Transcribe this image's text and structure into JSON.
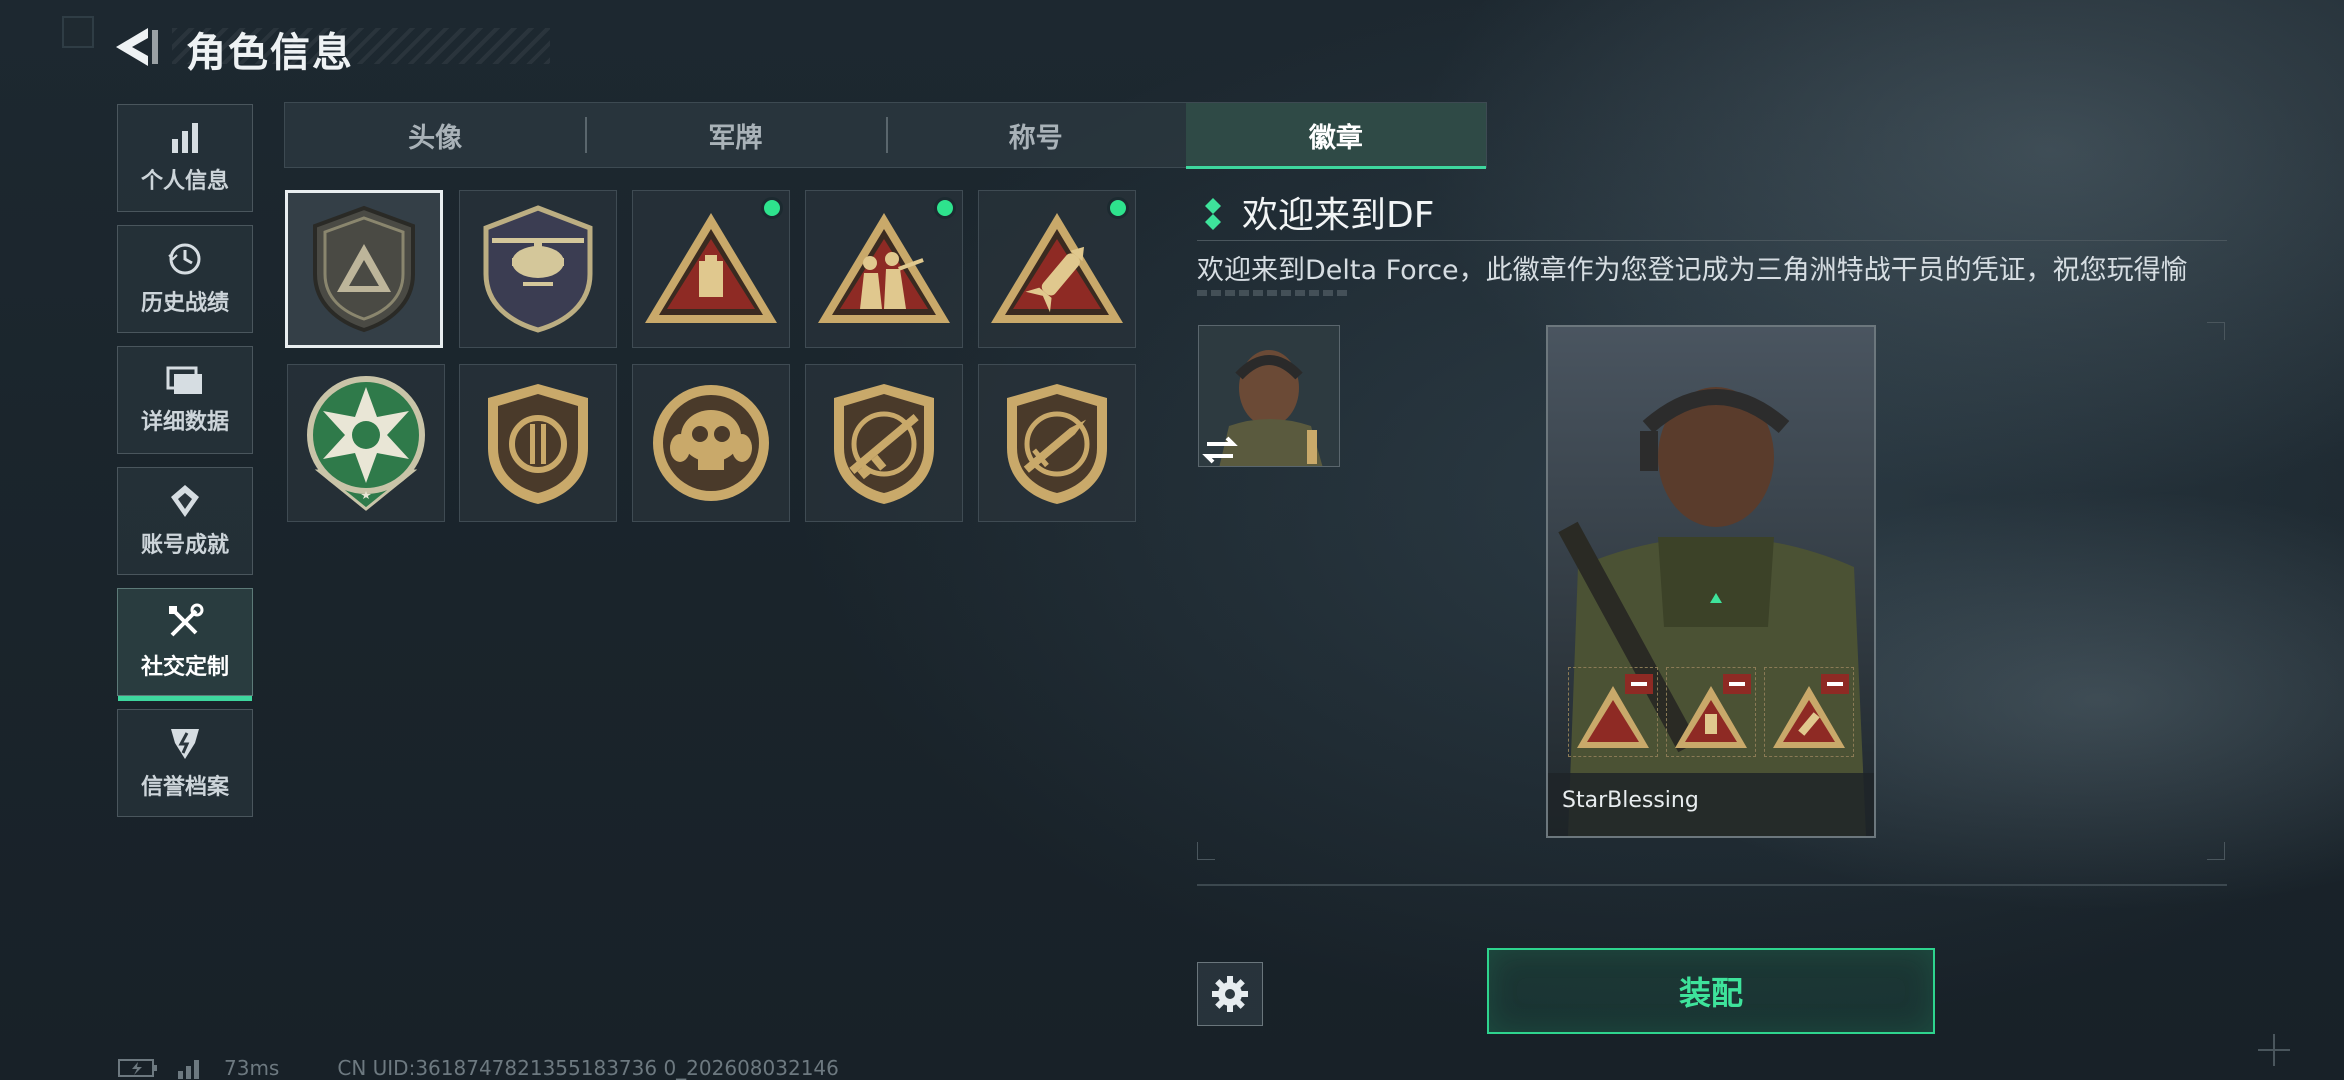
{
  "header": {
    "title": "角色信息",
    "back_icon": "back-arrow-icon"
  },
  "sidebar": {
    "items": [
      {
        "label": "个人信息",
        "icon": "bar-chart-icon"
      },
      {
        "label": "历史战绩",
        "icon": "history-clock-icon"
      },
      {
        "label": "详细数据",
        "icon": "folder-icon"
      },
      {
        "label": "账号成就",
        "icon": "achievement-icon"
      },
      {
        "label": "社交定制",
        "icon": "tools-icon",
        "active": true
      },
      {
        "label": "信誉档案",
        "icon": "reputation-icon"
      }
    ]
  },
  "tabs": [
    {
      "label": "头像"
    },
    {
      "label": "军牌"
    },
    {
      "label": "称号"
    },
    {
      "label": "徽章",
      "active": true
    }
  ],
  "badges": [
    {
      "name": "delta-triangle-badge",
      "equipped": false,
      "selected": true
    },
    {
      "name": "helicopter-badge",
      "equipped": false
    },
    {
      "name": "supply-triangle-badge",
      "equipped": true
    },
    {
      "name": "soldiers-triangle-badge",
      "equipped": true
    },
    {
      "name": "rocket-triangle-badge",
      "equipped": true
    },
    {
      "name": "star-green-badge",
      "equipped": false
    },
    {
      "name": "round-shield-badge",
      "equipped": false
    },
    {
      "name": "skull-crest-badge",
      "equipped": false
    },
    {
      "name": "rifle-shield-badge",
      "equipped": false
    },
    {
      "name": "knife-shield-badge",
      "equipped": false
    }
  ],
  "detail": {
    "title": "欢迎来到DF",
    "description": "欢迎来到Delta Force，此徽章作为您登记成为三角洲特战干员的凭证，祝您玩得愉"
  },
  "preview": {
    "player_name": "StarBlessing"
  },
  "actions": {
    "equip_label": "装配",
    "settings_icon": "gear-icon"
  },
  "status_bar": {
    "ping": "73ms",
    "uid": "CN UID:3618747821355183736 0_202608032146"
  },
  "colors": {
    "accent": "#2ed48e",
    "badge_gold": "#c9a96a",
    "badge_red": "#8e2a24",
    "badge_green": "#2f7a4a"
  }
}
